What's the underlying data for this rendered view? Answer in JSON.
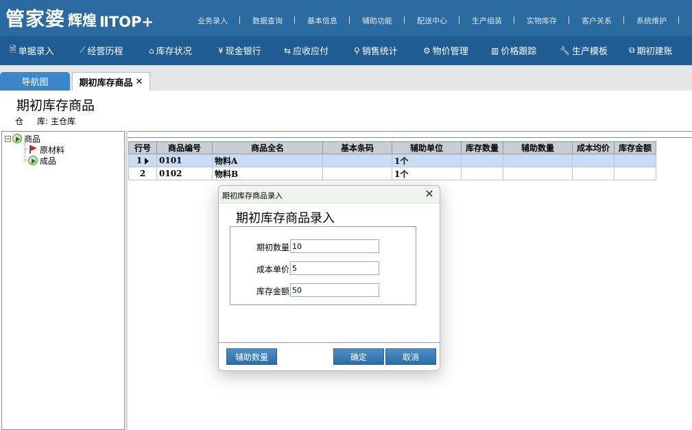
{
  "header": {
    "logo_main": "管家婆",
    "logo_sub": "辉煌",
    "logo_ver": "ⅡTOP+",
    "top_menu": [
      "业务录入",
      "数据查询",
      "基本信息",
      "辅助功能",
      "配送中心",
      "生产组装",
      "实物库存",
      "客户关系",
      "系统维护"
    ]
  },
  "navbar": {
    "items": [
      {
        "icon": "document-icon",
        "glyph": "🖹",
        "label": "单据录入"
      },
      {
        "icon": "line-chart-icon",
        "glyph": "⟋",
        "label": "经营历程"
      },
      {
        "icon": "home-icon",
        "glyph": "⌂",
        "label": "库存状况"
      },
      {
        "icon": "yen-icon",
        "glyph": "¥",
        "label": "现金银行"
      },
      {
        "icon": "exchange-icon",
        "glyph": "⇆",
        "label": "应收应付"
      },
      {
        "icon": "search-icon",
        "glyph": "⚲",
        "label": "销售统计"
      },
      {
        "icon": "gear-icon",
        "glyph": "⚙",
        "label": "物价管理"
      },
      {
        "icon": "bar-chart-icon",
        "glyph": "▥",
        "label": "价格跟踪"
      },
      {
        "icon": "wrench-icon",
        "glyph": "🔧",
        "label": "生产模板"
      },
      {
        "icon": "external-link-icon",
        "glyph": "⧉",
        "label": "期初建账"
      }
    ]
  },
  "tabs": {
    "nav_label": "导航图",
    "active_label": "期初库存商品",
    "close_glyph": "✕"
  },
  "page": {
    "title": "期初库存商品",
    "warehouse_label_a": "仓",
    "warehouse_label_b": "库:",
    "warehouse_value": "主仓库"
  },
  "tree": {
    "root": "商品",
    "children": [
      "原材料",
      "成品"
    ]
  },
  "grid": {
    "columns": [
      "行号",
      "商品编号",
      "商品全名",
      "基本条码",
      "辅助单位",
      "库存数量",
      "辅助数量",
      "成本均价",
      "库存金额"
    ],
    "rows": [
      {
        "no": "1",
        "code": "0101",
        "name": "物料A",
        "barcode": "",
        "unit": "1个",
        "qty": "",
        "aux_qty": "",
        "avg_cost": "",
        "amount": "",
        "selected": true
      },
      {
        "no": "2",
        "code": "0102",
        "name": "物料B",
        "barcode": "",
        "unit": "1个",
        "qty": "",
        "aux_qty": "",
        "avg_cost": "",
        "amount": "",
        "selected": false
      }
    ]
  },
  "dialog": {
    "title": "期初库存商品录入",
    "close_glyph": "✕",
    "heading": "期初库存商品录入",
    "fields": [
      {
        "label": "期初数量",
        "value": "10"
      },
      {
        "label": "成本单价",
        "value": "5"
      },
      {
        "label": "库存金额",
        "value": "50"
      }
    ],
    "aux_button": "辅助数量",
    "ok_button": "确定",
    "cancel_button": "取消"
  }
}
